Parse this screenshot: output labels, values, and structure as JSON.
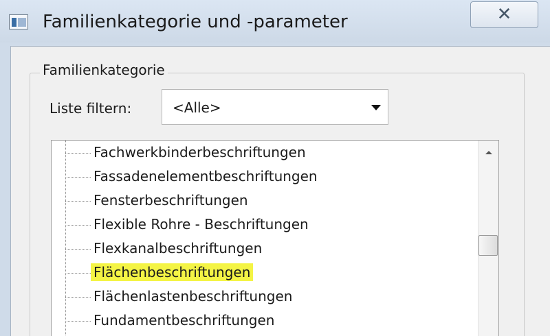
{
  "window": {
    "title": "Familienkategorie und -parameter",
    "close_glyph": "✕"
  },
  "group": {
    "label": "Familienkategorie"
  },
  "filter": {
    "label": "Liste filtern:",
    "value": "<Alle>"
  },
  "tree": {
    "items": [
      {
        "label": "Fachwerkbinderbeschriftungen",
        "highlighted": false
      },
      {
        "label": "Fassadenelementbeschriftungen",
        "highlighted": false
      },
      {
        "label": "Fensterbeschriftungen",
        "highlighted": false
      },
      {
        "label": "Flexible Rohre - Beschriftungen",
        "highlighted": false
      },
      {
        "label": "Flexkanalbeschriftungen",
        "highlighted": false
      },
      {
        "label": "Flächenbeschriftungen",
        "highlighted": true
      },
      {
        "label": "Flächenlastenbeschriftungen",
        "highlighted": false
      },
      {
        "label": "Fundamentbeschriftungen",
        "highlighted": false
      }
    ]
  },
  "icons": {
    "app": "dialog-window-icon",
    "close": "close-icon",
    "dropdown": "chevron-down-icon",
    "scroll_up": "scroll-up-arrow-icon"
  },
  "colors": {
    "highlight": "#f4f445",
    "titlebar": "#cfdbe9"
  }
}
